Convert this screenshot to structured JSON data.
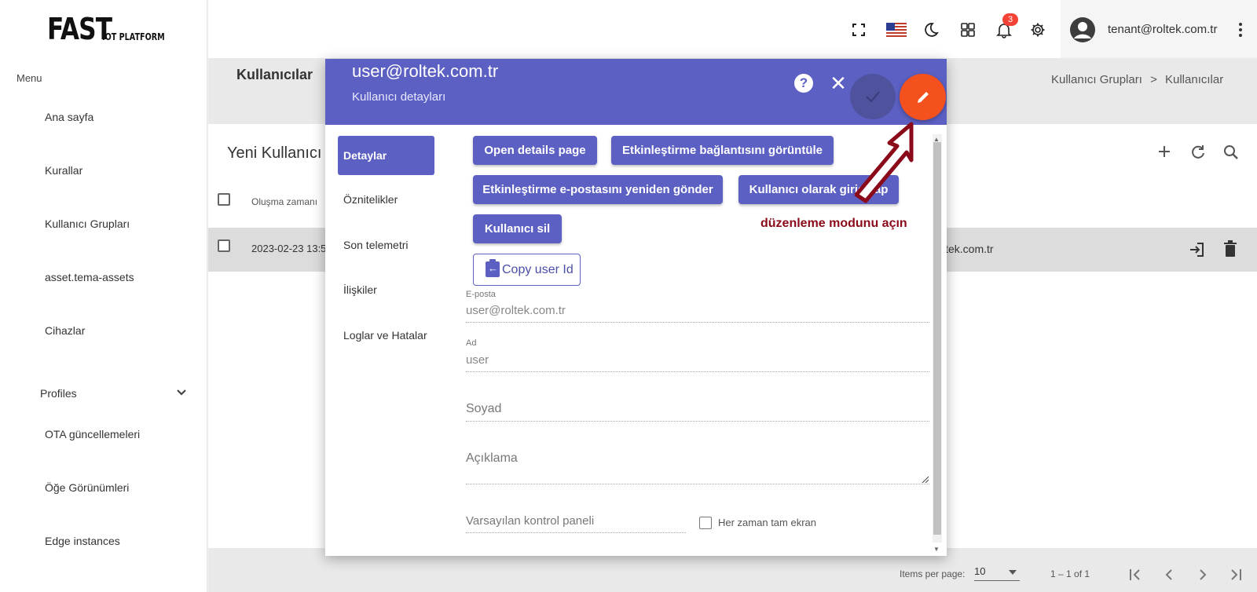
{
  "app": {
    "logo_main": "FAST",
    "logo_sub": "IOT PLATFORM"
  },
  "sidebar": {
    "menu_label": "Menu",
    "items": [
      {
        "label": "Ana sayfa"
      },
      {
        "label": "Kurallar"
      },
      {
        "label": "Kullanıcı Grupları"
      },
      {
        "label": "asset.tema-assets"
      },
      {
        "label": "Cihazlar"
      },
      {
        "label": "Profiles"
      },
      {
        "label": "OTA güncellemeleri"
      },
      {
        "label": "Öğe Görünümleri"
      },
      {
        "label": "Edge instances"
      }
    ]
  },
  "topbar": {
    "notification_count": "3",
    "user_email": "tenant@roltek.com.tr"
  },
  "page": {
    "title": "Kullanıcılar",
    "breadcrumb": [
      "Kullanıcı Grupları",
      ">",
      "Kullanıcılar"
    ],
    "table_title": "Yeni Kullanıcı",
    "column_header": "Oluşma zamanı",
    "row": {
      "date": "2023-02-23 13:5",
      "email_fragment": "ltek.com.tr"
    }
  },
  "pagination": {
    "items_per_page_label": "Items per page:",
    "items_per_page_value": "10",
    "range": "1 – 1 of 1"
  },
  "dialog": {
    "title": "user@roltek.com.tr",
    "subtitle": "Kullanıcı detayları",
    "help": "?",
    "tabs": [
      "Detaylar",
      "Öznitelikler",
      "Son telemetri",
      "İlişkiler",
      "Loglar ve Hatalar"
    ],
    "buttons": {
      "open_details": "Open details page",
      "show_activation_link": "Etkinleştirme bağlantısını görüntüle",
      "resend_activation": "Etkinleştirme e-postasını yeniden gönder",
      "login_as_user": "Kullanıcı olarak giriş yap",
      "delete_user": "Kullanıcı sil",
      "copy_user_id": "Copy user Id"
    },
    "fields": {
      "email_label": "E-posta",
      "email_value": "user@roltek.com.tr",
      "first_name_label": "Ad",
      "first_name_value": "user",
      "last_name_placeholder": "Soyad",
      "description_placeholder": "Açıklama",
      "default_dashboard_placeholder": "Varsayılan kontrol paneli",
      "always_fullscreen_label": "Her zaman tam ekran"
    }
  },
  "annotation": {
    "text": "düzenleme modunu açın",
    "color": "#8b0a1a"
  },
  "colors": {
    "primary": "#5c60c3",
    "accent": "#f4511e"
  }
}
